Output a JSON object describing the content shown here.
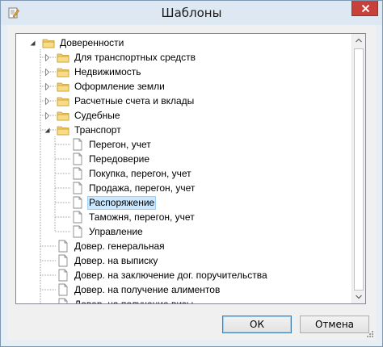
{
  "window": {
    "title": "Шаблоны",
    "app_icon": "edit-document-icon"
  },
  "tree": {
    "items": [
      {
        "label": "Доверенности",
        "kind": "folder",
        "expanded": true
      },
      {
        "label": "Для транспортных средств",
        "kind": "folder",
        "expanded": false
      },
      {
        "label": "Недвижимость",
        "kind": "folder",
        "expanded": false
      },
      {
        "label": "Оформление земли",
        "kind": "folder",
        "expanded": false
      },
      {
        "label": "Расчетные счета и вклады",
        "kind": "folder",
        "expanded": false
      },
      {
        "label": "Судебные",
        "kind": "folder",
        "expanded": false
      },
      {
        "label": "Транспорт",
        "kind": "folder",
        "expanded": true
      },
      {
        "label": "Перегон, учет",
        "kind": "document"
      },
      {
        "label": "Передоверие",
        "kind": "document"
      },
      {
        "label": "Покупка, перегон, учет",
        "kind": "document"
      },
      {
        "label": "Продажа, перегон, учет",
        "kind": "document"
      },
      {
        "label": "Распоряжение",
        "kind": "document",
        "selected": true
      },
      {
        "label": "Таможня, перегон, учет",
        "kind": "document"
      },
      {
        "label": "Управление",
        "kind": "document"
      },
      {
        "label": "Довер. генеральная",
        "kind": "document"
      },
      {
        "label": "Довер. на выписку",
        "kind": "document"
      },
      {
        "label": "Довер. на заключение дог. поручительства",
        "kind": "document"
      },
      {
        "label": "Довер. на получение алиментов",
        "kind": "document"
      },
      {
        "label": "Довер. на получение визы",
        "kind": "document"
      }
    ]
  },
  "buttons": {
    "ok": "ОК",
    "cancel": "Отмена"
  },
  "colors": {
    "selection": "#cce8ff",
    "selection_border": "#99d1ff",
    "close": "#c7403a",
    "folder": "#f3cf6c"
  }
}
